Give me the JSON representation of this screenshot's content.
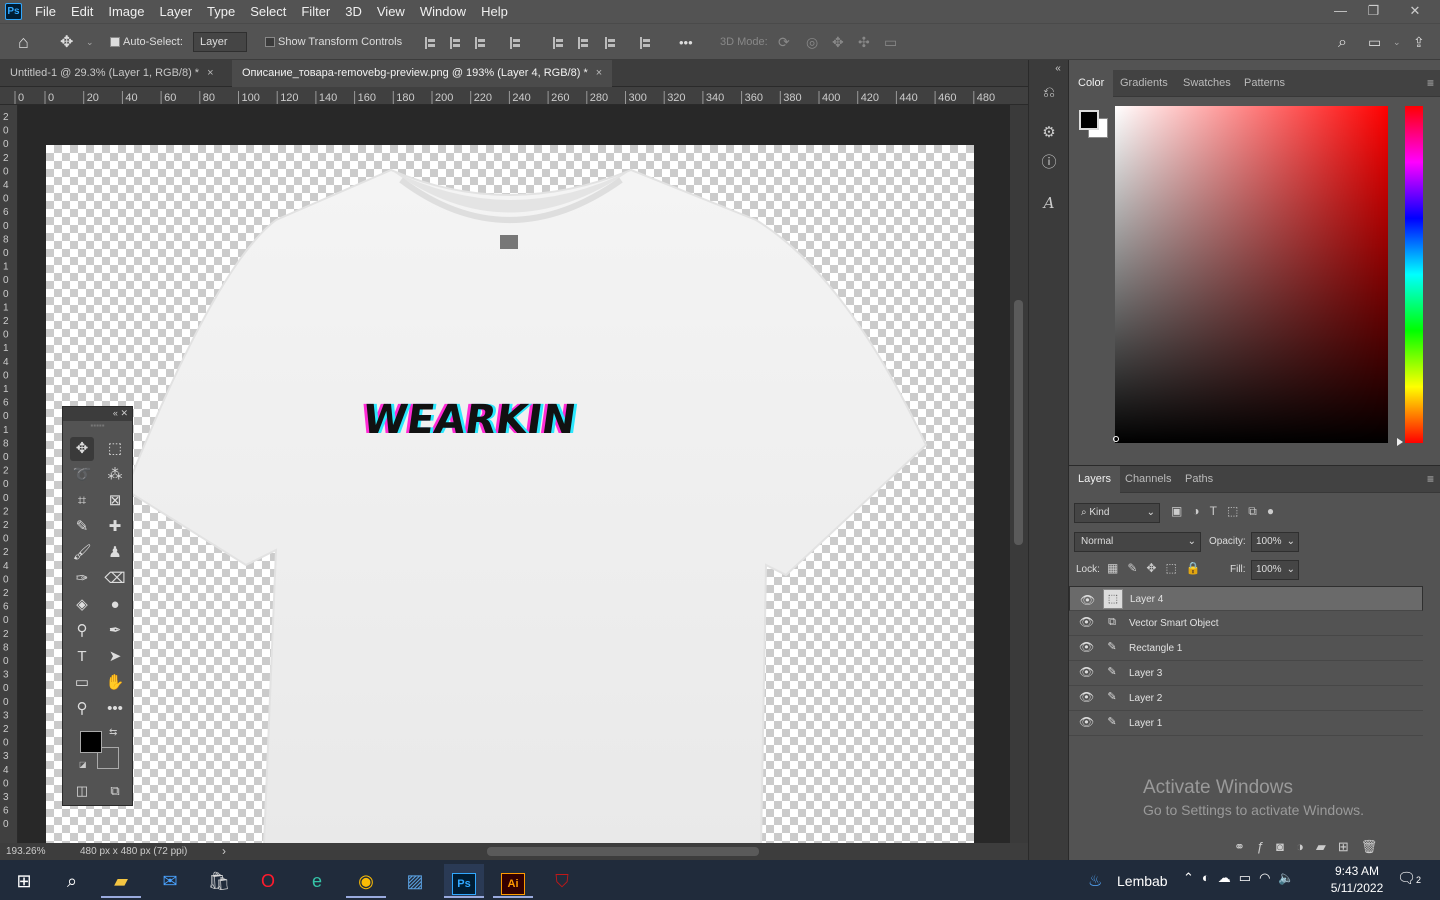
{
  "app": {
    "logo": "Ps"
  },
  "menu": [
    "File",
    "Edit",
    "Image",
    "Layer",
    "Type",
    "Select",
    "Filter",
    "3D",
    "View",
    "Window",
    "Help"
  ],
  "window_controls": {
    "minimize": "—",
    "restore": "❐",
    "close": "✕"
  },
  "options": {
    "auto_select_label": "Auto-Select:",
    "auto_select_value": "Layer",
    "show_transform": "Show Transform Controls",
    "mode_3d": "3D Mode:",
    "more": "•••"
  },
  "tabs": [
    {
      "label": "Untitled-1 @ 29.3% (Layer 1, RGB/8) *"
    },
    {
      "label": "Описание_товара-removebg-preview.png @ 193% (Layer 4, RGB/8) *"
    }
  ],
  "ruler_h": [
    "0",
    "0",
    "20",
    "40",
    "60",
    "80",
    "100",
    "120",
    "140",
    "160",
    "180",
    "200",
    "220",
    "240",
    "260",
    "280",
    "300",
    "320",
    "340",
    "360",
    "380",
    "400",
    "420",
    "440",
    "460",
    "480"
  ],
  "ruler_v": [
    "2",
    "0",
    "0",
    "2",
    "0",
    "4",
    "0",
    "6",
    "0",
    "8",
    "0",
    "1",
    "0",
    "0",
    "1",
    "2",
    "0",
    "1",
    "4",
    "0",
    "1",
    "6",
    "0",
    "1",
    "8",
    "0",
    "2",
    "0",
    "0",
    "2",
    "2",
    "0",
    "2",
    "4",
    "0",
    "2",
    "6",
    "0",
    "2",
    "8",
    "0",
    "3",
    "0",
    "0",
    "3",
    "2",
    "0",
    "3",
    "4",
    "0",
    "3",
    "6",
    "0"
  ],
  "canvas": {
    "text": "WEARKIN"
  },
  "status": {
    "zoom": "193.26%",
    "doc_info": "480 px x 480 px (72 ppi)",
    "arrow": "›"
  },
  "color_panel": {
    "tabs": [
      "Color",
      "Gradients",
      "Swatches",
      "Patterns"
    ],
    "active": "Color",
    "foreground": "#000000",
    "background": "#ffffff",
    "hue": "#ff0000"
  },
  "layers_panel": {
    "tabs": [
      "Layers",
      "Channels",
      "Paths"
    ],
    "active": "Layers",
    "filter": "Kind",
    "blend_mode": "Normal",
    "opacity_label": "Opacity:",
    "opacity": "100%",
    "lock_label": "Lock:",
    "fill_label": "Fill:",
    "fill": "100%",
    "layers": [
      {
        "name": "Layer 4",
        "selected": true,
        "icon": "pixel"
      },
      {
        "name": "Vector Smart Object",
        "selected": false,
        "icon": "smart-object"
      },
      {
        "name": "Rectangle 1",
        "selected": false,
        "icon": "brush"
      },
      {
        "name": "Layer 3",
        "selected": false,
        "icon": "brush"
      },
      {
        "name": "Layer 2",
        "selected": false,
        "icon": "brush"
      },
      {
        "name": "Layer 1",
        "selected": false,
        "icon": "brush"
      }
    ]
  },
  "watermark": {
    "title": "Activate Windows",
    "subtitle": "Go to Settings to activate Windows."
  },
  "taskbar": {
    "weather": "Lembab",
    "time": "9:43 AM",
    "date": "5/11/2022",
    "notifications": "2"
  }
}
